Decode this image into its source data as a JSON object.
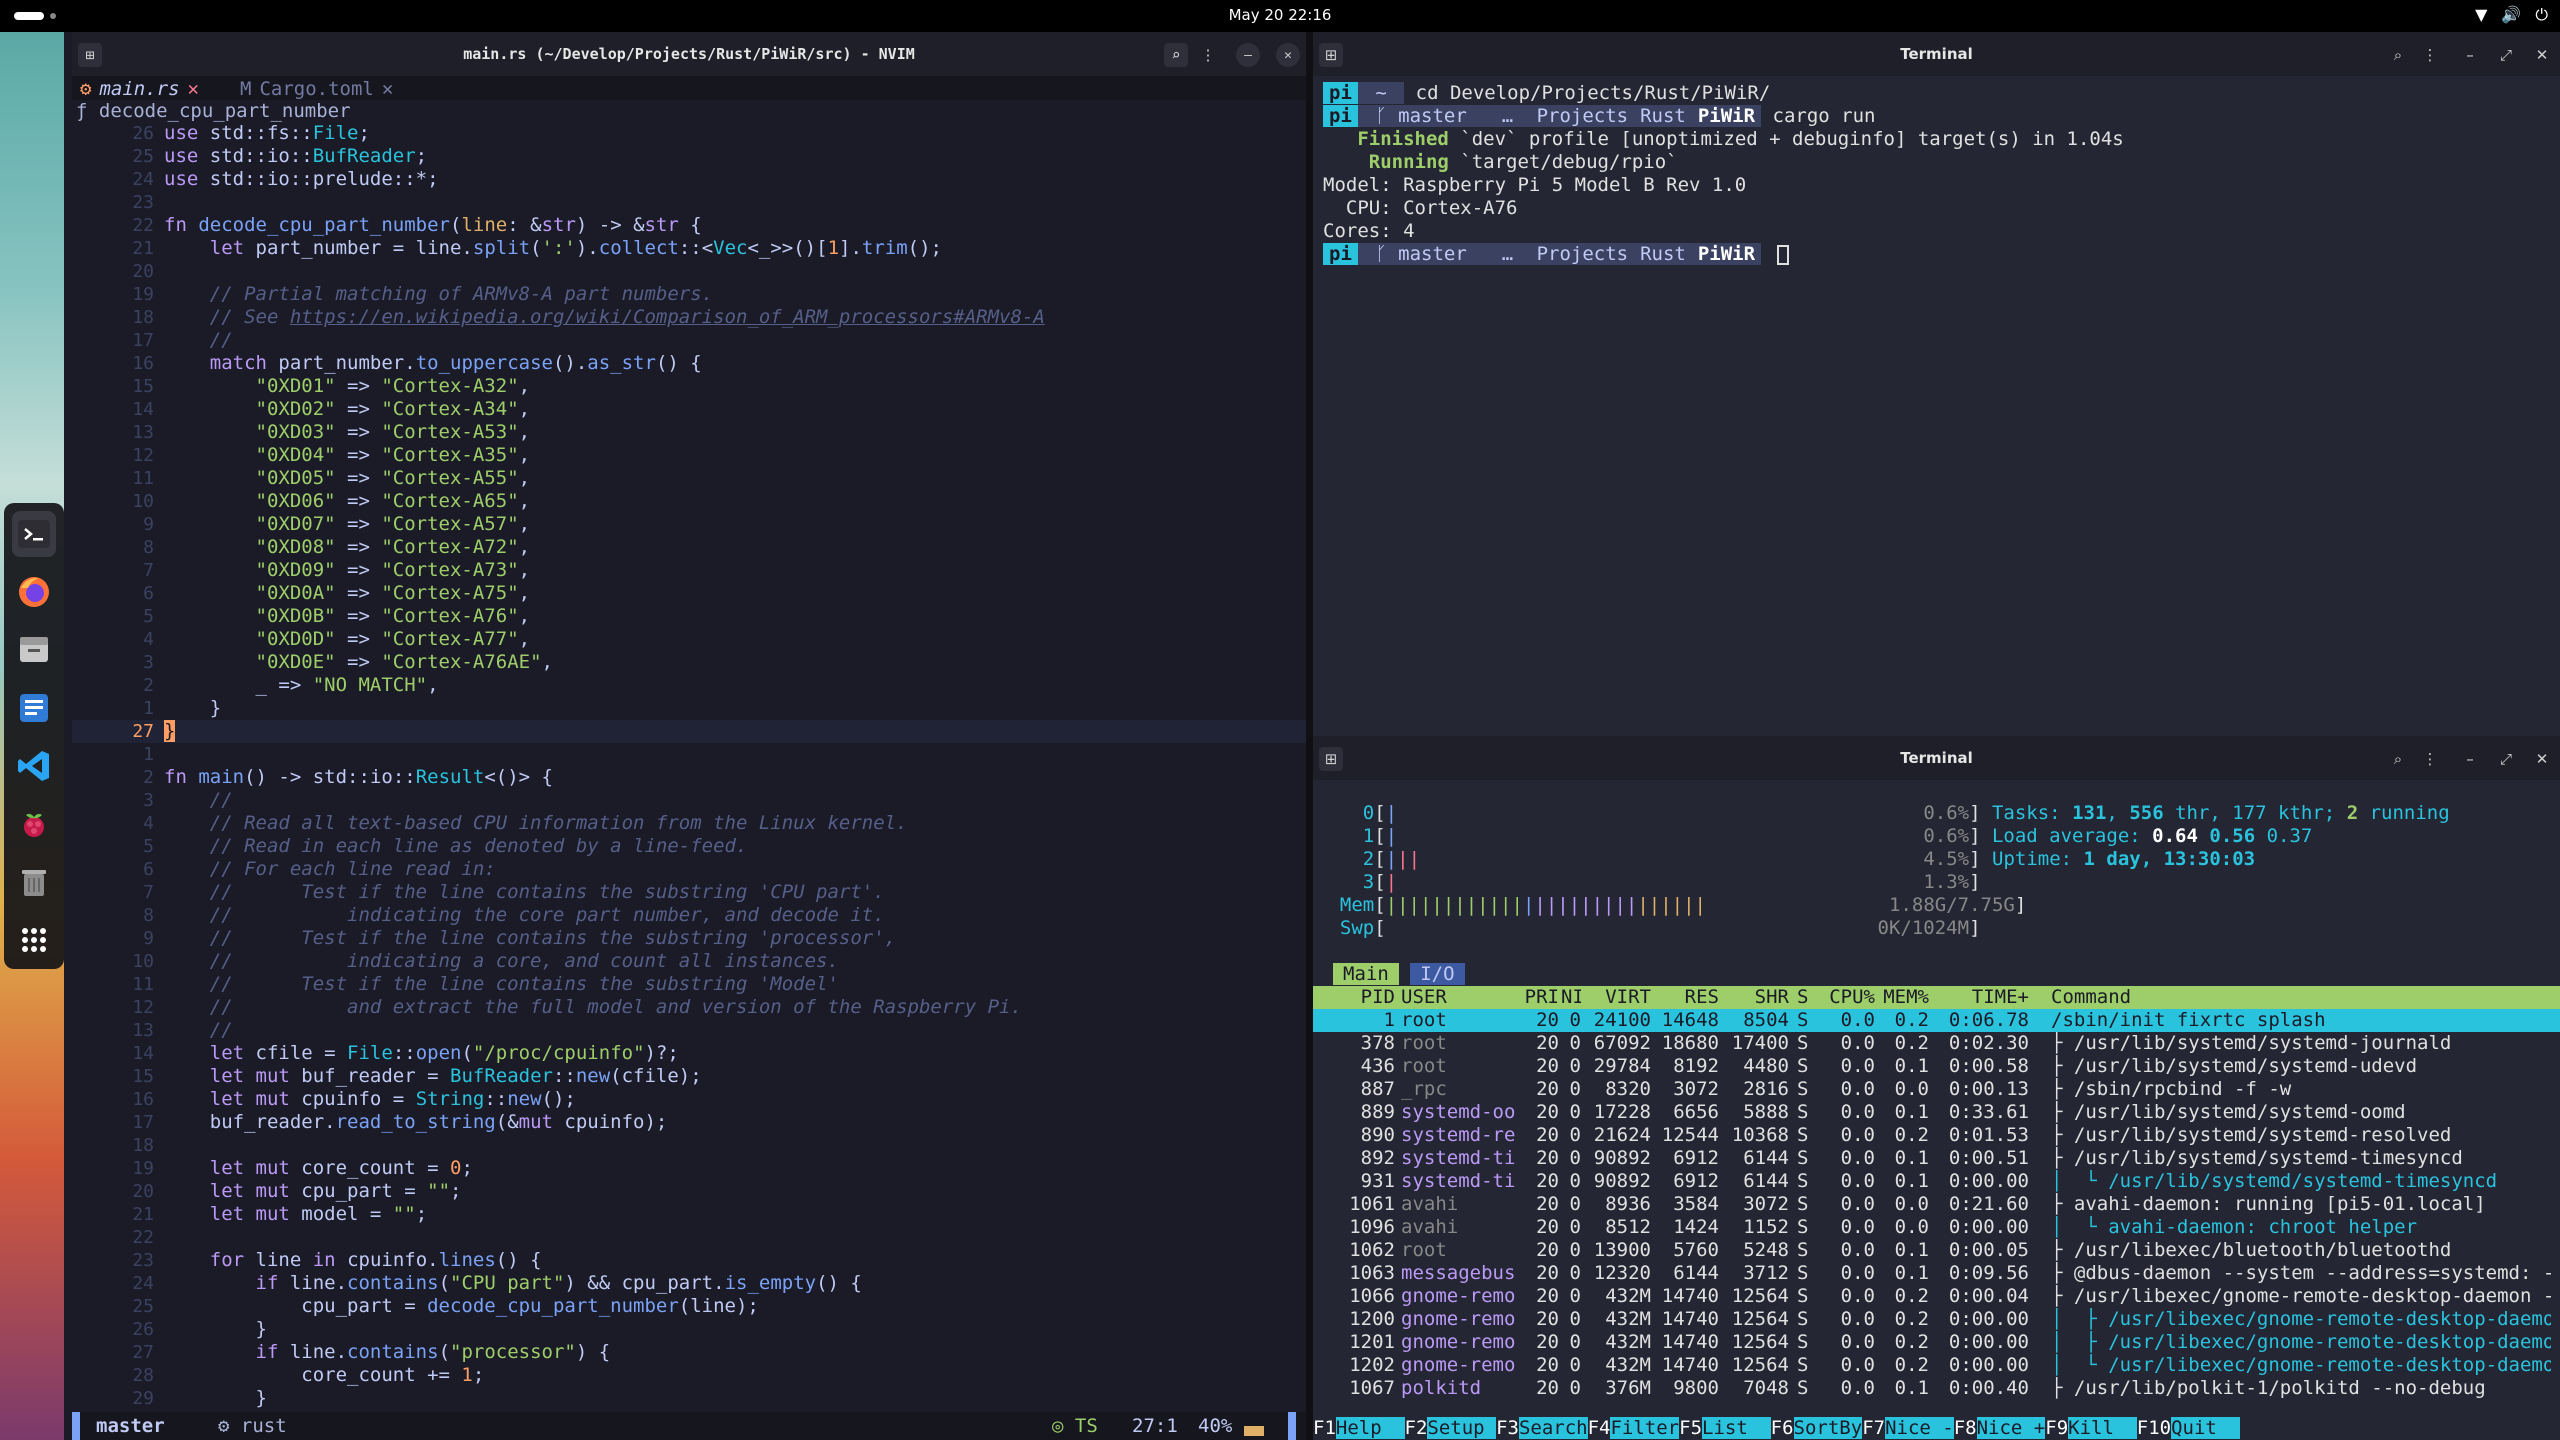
{
  "topbar": {
    "clock": "May 20 22:16"
  },
  "dock": [
    "terminal-icon",
    "firefox-icon",
    "files-icon",
    "docs-icon",
    "vscode-icon",
    "raspberry-icon",
    "trash-icon",
    "apps-grid-icon"
  ],
  "nvim": {
    "title": "main.rs (~/Develop/Projects/Rust/PiWiR/src) - NVIM",
    "tabs": [
      {
        "icon": "⚙",
        "label": "main.rs",
        "close": "✕"
      },
      {
        "icon": "M",
        "label": "Cargo.toml",
        "close": "✕"
      }
    ],
    "winbar": "ƒ decode_cpu_part_number",
    "status": {
      "mode": "",
      "branch": " master",
      "file": "⚙ rust",
      "lsp": "◎ TS",
      "position": "27:1",
      "percent": "40%"
    }
  },
  "code_lines": [
    {
      "ln": "26",
      "html": "<span class=\"kw\">use</span> std::fs::<span class=\"ty\">File</span>;"
    },
    {
      "ln": "25",
      "html": "<span class=\"kw\">use</span> std::io::<span class=\"ty\">BufReader</span>;"
    },
    {
      "ln": "24",
      "html": "<span class=\"kw\">use</span> std::io::prelude::*;"
    },
    {
      "ln": "23",
      "html": ""
    },
    {
      "ln": "22",
      "html": "<span class=\"kw\">fn</span> <span class=\"fn\">decode_cpu_part_number</span>(<span class=\"pa\">line</span>: &amp;<span class=\"kw\">str</span>) -&gt; &amp;<span class=\"kw\">str</span> {"
    },
    {
      "ln": "21",
      "html": "    <span class=\"kw\">let</span> part_number = line.<span class=\"fn\">split</span>(<span class=\"st\">':'</span>).<span class=\"fn\">collect</span>::&lt;<span class=\"ty\">Vec</span>&lt;_&gt;&gt;()[<span class=\"nu\">1</span>].<span class=\"fn\">trim</span>();"
    },
    {
      "ln": "20",
      "html": ""
    },
    {
      "ln": "19",
      "html": "    <span class=\"cm\">// Partial matching of ARMv8-A part numbers.</span>"
    },
    {
      "ln": "18",
      "html": "    <span class=\"cm\">// See </span><span class=\"url\">https://en.wikipedia.org/wiki/Comparison_of_ARM_processors#ARMv8-A</span>"
    },
    {
      "ln": "17",
      "html": "    <span class=\"cm\">//</span>"
    },
    {
      "ln": "16",
      "html": "    <span class=\"kw\">match</span> part_number.<span class=\"fn\">to_uppercase</span>().<span class=\"fn\">as_str</span>() {"
    },
    {
      "ln": "15",
      "html": "        <span class=\"st\">\"0XD01\"</span> =&gt; <span class=\"st\">\"Cortex-A32\"</span>,"
    },
    {
      "ln": "14",
      "html": "        <span class=\"st\">\"0XD02\"</span> =&gt; <span class=\"st\">\"Cortex-A34\"</span>,"
    },
    {
      "ln": "13",
      "html": "        <span class=\"st\">\"0XD03\"</span> =&gt; <span class=\"st\">\"Cortex-A53\"</span>,"
    },
    {
      "ln": "12",
      "html": "        <span class=\"st\">\"0XD04\"</span> =&gt; <span class=\"st\">\"Cortex-A35\"</span>,"
    },
    {
      "ln": "11",
      "html": "        <span class=\"st\">\"0XD05\"</span> =&gt; <span class=\"st\">\"Cortex-A55\"</span>,"
    },
    {
      "ln": "10",
      "html": "        <span class=\"st\">\"0XD06\"</span> =&gt; <span class=\"st\">\"Cortex-A65\"</span>,"
    },
    {
      "ln": "9",
      "html": "        <span class=\"st\">\"0XD07\"</span> =&gt; <span class=\"st\">\"Cortex-A57\"</span>,"
    },
    {
      "ln": "8",
      "html": "        <span class=\"st\">\"0XD08\"</span> =&gt; <span class=\"st\">\"Cortex-A72\"</span>,"
    },
    {
      "ln": "7",
      "html": "        <span class=\"st\">\"0XD09\"</span> =&gt; <span class=\"st\">\"Cortex-A73\"</span>,"
    },
    {
      "ln": "6",
      "html": "        <span class=\"st\">\"0XD0A\"</span> =&gt; <span class=\"st\">\"Cortex-A75\"</span>,"
    },
    {
      "ln": "5",
      "html": "        <span class=\"st\">\"0XD0B\"</span> =&gt; <span class=\"st\">\"Cortex-A76\"</span>,"
    },
    {
      "ln": "4",
      "html": "        <span class=\"st\">\"0XD0D\"</span> =&gt; <span class=\"st\">\"Cortex-A77\"</span>,"
    },
    {
      "ln": "3",
      "html": "        <span class=\"st\">\"0XD0E\"</span> =&gt; <span class=\"st\">\"Cortex-A76AE\"</span>,"
    },
    {
      "ln": "2",
      "html": "        _ =&gt; <span class=\"st\">\"NO MATCH\"</span>,"
    },
    {
      "ln": "1",
      "html": "    }"
    },
    {
      "ln": "27",
      "html": "<span class=\"cursor\">}</span>",
      "cur": true
    },
    {
      "ln": "1",
      "html": ""
    },
    {
      "ln": "2",
      "html": "<span class=\"kw\">fn</span> <span class=\"fn\">main</span>() -&gt; std::io::<span class=\"ty\">Result</span>&lt;()&gt; {"
    },
    {
      "ln": "3",
      "html": "    <span class=\"cm\">//</span>"
    },
    {
      "ln": "4",
      "html": "    <span class=\"cm\">// Read all text-based CPU information from the Linux kernel.</span>"
    },
    {
      "ln": "5",
      "html": "    <span class=\"cm\">// Read in each line as denoted by a line-feed.</span>"
    },
    {
      "ln": "6",
      "html": "    <span class=\"cm\">// For each line read in:</span>"
    },
    {
      "ln": "7",
      "html": "    <span class=\"cm\">//      Test if the line contains the substring 'CPU part'.</span>"
    },
    {
      "ln": "8",
      "html": "    <span class=\"cm\">//          indicating the core part number, and decode it.</span>"
    },
    {
      "ln": "9",
      "html": "    <span class=\"cm\">//      Test if the line contains the substring 'processor',</span>"
    },
    {
      "ln": "10",
      "html": "    <span class=\"cm\">//          indicating a core, and count all instances.</span>"
    },
    {
      "ln": "11",
      "html": "    <span class=\"cm\">//      Test if the line contains the substring 'Model'</span>"
    },
    {
      "ln": "12",
      "html": "    <span class=\"cm\">//          and extract the full model and version of the Raspberry Pi.</span>"
    },
    {
      "ln": "13",
      "html": "    <span class=\"cm\">//</span>"
    },
    {
      "ln": "14",
      "html": "    <span class=\"kw\">let</span> cfile = <span class=\"ty\">File</span>::<span class=\"fn\">open</span>(<span class=\"st\">\"/proc/cpuinfo\"</span>)?;"
    },
    {
      "ln": "15",
      "html": "    <span class=\"kw\">let mut</span> buf_reader = <span class=\"ty\">BufReader</span>::<span class=\"fn\">new</span>(cfile);"
    },
    {
      "ln": "16",
      "html": "    <span class=\"kw\">let mut</span> cpuinfo = <span class=\"ty\">String</span>::<span class=\"fn\">new</span>();"
    },
    {
      "ln": "17",
      "html": "    buf_reader.<span class=\"fn\">read_to_string</span>(&amp;<span class=\"kw\">mut</span> cpuinfo);"
    },
    {
      "ln": "18",
      "html": ""
    },
    {
      "ln": "19",
      "html": "    <span class=\"kw\">let mut</span> core_count = <span class=\"nu\">0</span>;"
    },
    {
      "ln": "20",
      "html": "    <span class=\"kw\">let mut</span> cpu_part = <span class=\"st\">\"\"</span>;"
    },
    {
      "ln": "21",
      "html": "    <span class=\"kw\">let mut</span> model = <span class=\"st\">\"\"</span>;"
    },
    {
      "ln": "22",
      "html": ""
    },
    {
      "ln": "23",
      "html": "    <span class=\"kw\">for</span> line <span class=\"kw\">in</span> cpuinfo.<span class=\"fn\">lines</span>() {"
    },
    {
      "ln": "24",
      "html": "        <span class=\"kw\">if</span> line.<span class=\"fn\">contains</span>(<span class=\"st\">\"CPU part\"</span>) &amp;&amp; cpu_part.<span class=\"fn\">is_empty</span>() {"
    },
    {
      "ln": "25",
      "html": "            cpu_part = <span class=\"fn\">decode_cpu_part_number</span>(line);"
    },
    {
      "ln": "26",
      "html": "        }"
    },
    {
      "ln": "27",
      "html": "        <span class=\"kw\">if</span> line.<span class=\"fn\">contains</span>(<span class=\"st\">\"processor\"</span>) {"
    },
    {
      "ln": "28",
      "html": "            core_count += <span class=\"nu\">1</span>;"
    },
    {
      "ln": "29",
      "html": "        }"
    }
  ],
  "term1": {
    "title": "Terminal",
    "lines": [
      "<span class=\"pl-pi\">pi</span><span class=\"pl-seg\"> ~ </span> cd Develop/Projects/Rust/PiWiR/",
      "<span class=\"pl-pi\">pi</span><span class=\"pl-seg\"> ᚴ master </span><span class=\"pl-seg\"> … </span><span class=\"pl-seg\">Projects</span><span class=\"pl-seg\">Rust</span><span class=\"pl-bold\">PiWiR</span> cargo run",
      "   <span class=\"green-b\">Finished</span> `dev` profile [unoptimized + debuginfo] target(s) in 1.04s",
      "    <span class=\"green-b\">Running</span> `target/debug/rpio`",
      "Model: Raspberry Pi 5 Model B Rev 1.0",
      "  CPU: Cortex-A76",
      "Cores: 4",
      "<span class=\"pl-pi\">pi</span><span class=\"pl-seg\"> ᚴ master </span><span class=\"pl-seg\"> … </span><span class=\"pl-seg\">Projects</span><span class=\"pl-seg\">Rust</span><span class=\"pl-bold\">PiWiR</span> <span class=\"tcursor\"></span>"
    ]
  },
  "term2": {
    "title": "Terminal",
    "meters": [
      "    <span class=\"hc\">0</span>[<span class=\"hb\">|</span>                                              <span class=\"hd\">0.6%</span>] <span class=\"hc\">Tasks:</span> <span class=\"hc\" style=\"font-weight:bold\">131</span><span class=\"hc\">,</span> <span class=\"hc\" style=\"font-weight:bold\">556</span><span class=\"hc\"> thr, </span><span class=\"hc\">177 kthr;</span> <span class=\"hg\" style=\"font-weight:bold\">2</span><span class=\"hc\"> running</span>",
      "    <span class=\"hc\">1</span>[<span class=\"hb\">|</span>                                              <span class=\"hd\">0.6%</span>] <span class=\"hc\">Load average:</span> <span style=\"color:#fff;font-weight:bold\">0.64</span> <span class=\"hc\" style=\"font-weight:bold\">0.56</span> <span class=\"hc\">0.37</span>",
      "    <span class=\"hc\">2</span>[<span class=\"hb\">|</span><span class=\"hr\">||</span>                                            <span class=\"hd\">4.5%</span>] <span class=\"hc\">Uptime:</span> <span class=\"hc\" style=\"font-weight:bold\">1 day, 13:30:03</span>",
      "    <span class=\"hc\">3</span>[<span class=\"hr\">|</span>                                              <span class=\"hd\">1.3%</span>]",
      "  <span class=\"hc\">Mem</span>[<span class=\"hg\">||||||||||||</span><span class=\"hb\">|</span><span class=\"hm\">|||||||||</span><span class=\"hy\">||||||</span>                <span class=\"hd\">1.88G/7.75G</span>]",
      "  <span class=\"hc\">Swp</span>[                                           <span class=\"hd\">0K/1024M</span>]"
    ],
    "tabs": [
      "Main",
      "I/O"
    ],
    "header": [
      "PID",
      "USER",
      "PRI",
      "NI",
      "VIRT",
      "RES",
      "SHR",
      "S",
      "CPU%",
      "MEM%",
      "TIME+",
      "Command"
    ],
    "procs": [
      [
        "1",
        "root",
        "20",
        "0",
        "24100",
        "14648",
        "8504",
        "S",
        "0.0",
        "0.2",
        "0:06.78",
        "/sbin/init fixrtc splash"
      ],
      [
        "378",
        "root",
        "20",
        "0",
        "67092",
        "18680",
        "17400",
        "S",
        "0.0",
        "0.2",
        "0:02.30",
        "├ /usr/lib/systemd/systemd-journald"
      ],
      [
        "436",
        "root",
        "20",
        "0",
        "29784",
        "8192",
        "4480",
        "S",
        "0.0",
        "0.1",
        "0:00.58",
        "├ /usr/lib/systemd/systemd-udevd"
      ],
      [
        "887",
        "_rpc",
        "20",
        "0",
        "8320",
        "3072",
        "2816",
        "S",
        "0.0",
        "0.0",
        "0:00.13",
        "├ /sbin/rpcbind -f -w"
      ],
      [
        "889",
        "systemd-oo",
        "20",
        "0",
        "17228",
        "6656",
        "5888",
        "S",
        "0.0",
        "0.1",
        "0:33.61",
        "├ /usr/lib/systemd/systemd-oomd"
      ],
      [
        "890",
        "systemd-re",
        "20",
        "0",
        "21624",
        "12544",
        "10368",
        "S",
        "0.0",
        "0.2",
        "0:01.53",
        "├ /usr/lib/systemd/systemd-resolved"
      ],
      [
        "892",
        "systemd-ti",
        "20",
        "0",
        "90892",
        "6912",
        "6144",
        "S",
        "0.0",
        "0.1",
        "0:00.51",
        "├ /usr/lib/systemd/systemd-timesyncd"
      ],
      [
        "931",
        "systemd-ti",
        "20",
        "0",
        "90892",
        "6912",
        "6144",
        "S",
        "0.0",
        "0.1",
        "0:00.00",
        "│  └ /usr/lib/systemd/systemd-timesyncd"
      ],
      [
        "1061",
        "avahi",
        "20",
        "0",
        "8936",
        "3584",
        "3072",
        "S",
        "0.0",
        "0.0",
        "0:21.60",
        "├ avahi-daemon: running [pi5-01.local]"
      ],
      [
        "1096",
        "avahi",
        "20",
        "0",
        "8512",
        "1424",
        "1152",
        "S",
        "0.0",
        "0.0",
        "0:00.00",
        "│  └ avahi-daemon: chroot helper"
      ],
      [
        "1062",
        "root",
        "20",
        "0",
        "13900",
        "5760",
        "5248",
        "S",
        "0.0",
        "0.1",
        "0:00.05",
        "├ /usr/libexec/bluetooth/bluetoothd"
      ],
      [
        "1063",
        "messagebus",
        "20",
        "0",
        "12320",
        "6144",
        "3712",
        "S",
        "0.0",
        "0.1",
        "0:09.56",
        "├ @dbus-daemon --system --address=systemd: -"
      ],
      [
        "1066",
        "gnome-remo",
        "20",
        "0",
        "432M",
        "14740",
        "12564",
        "S",
        "0.0",
        "0.2",
        "0:00.04",
        "├ /usr/libexec/gnome-remote-desktop-daemon -"
      ],
      [
        "1200",
        "gnome-remo",
        "20",
        "0",
        "432M",
        "14740",
        "12564",
        "S",
        "0.0",
        "0.2",
        "0:00.00",
        "│  ├ /usr/libexec/gnome-remote-desktop-daemo"
      ],
      [
        "1201",
        "gnome-remo",
        "20",
        "0",
        "432M",
        "14740",
        "12564",
        "S",
        "0.0",
        "0.2",
        "0:00.00",
        "│  ├ /usr/libexec/gnome-remote-desktop-daemo"
      ],
      [
        "1202",
        "gnome-remo",
        "20",
        "0",
        "432M",
        "14740",
        "12564",
        "S",
        "0.0",
        "0.2",
        "0:00.00",
        "│  └ /usr/libexec/gnome-remote-desktop-daemo"
      ],
      [
        "1067",
        "polkitd",
        "20",
        "0",
        "376M",
        "9800",
        "7048",
        "S",
        "0.0",
        "0.1",
        "0:00.40",
        "├ /usr/lib/polkit-1/polkitd --no-debug"
      ]
    ],
    "fkeys": [
      [
        "F1",
        "Help"
      ],
      [
        "F2",
        "Setup"
      ],
      [
        "F3",
        "Search"
      ],
      [
        "F4",
        "Filter"
      ],
      [
        "F5",
        "List"
      ],
      [
        "F6",
        "SortBy"
      ],
      [
        "F7",
        "Nice -"
      ],
      [
        "F8",
        "Nice +"
      ],
      [
        "F9",
        "Kill"
      ],
      [
        "F10",
        "Quit"
      ]
    ]
  }
}
